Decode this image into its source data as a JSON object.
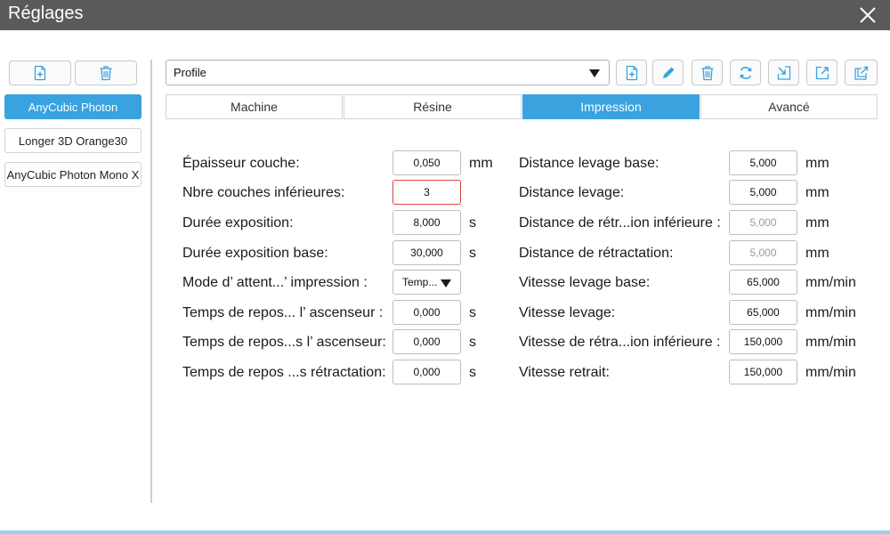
{
  "window": {
    "title": "Réglages"
  },
  "machines": [
    "AnyCubic Photon",
    "Longer 3D Orange30",
    "AnyCubic Photon Mono X"
  ],
  "profile": {
    "value": "Profile"
  },
  "tabs": [
    "Machine",
    "Résine",
    "Impression",
    "Avancé"
  ],
  "left_params": [
    {
      "label": "Épaisseur couche:",
      "value": "0,050",
      "unit": "mm"
    },
    {
      "label": "Nbre couches inférieures:",
      "value": "3",
      "unit": ""
    },
    {
      "label": "Durée exposition:",
      "value": "8,000",
      "unit": "s"
    },
    {
      "label": "Durée exposition base:",
      "value": "30,000",
      "unit": "s"
    },
    {
      "label": "Mode d’ attent...’ impression :",
      "value": "Temp...",
      "unit": ""
    },
    {
      "label": "Temps de repos... l’ ascenseur :",
      "value": "0,000",
      "unit": "s"
    },
    {
      "label": "Temps de repos...s l’ ascenseur:",
      "value": "0,000",
      "unit": "s"
    },
    {
      "label": "Temps de repos ...s rétractation:",
      "value": "0,000",
      "unit": "s"
    }
  ],
  "right_params": [
    {
      "label": "Distance levage base:",
      "value": "5,000",
      "unit": "mm"
    },
    {
      "label": "Distance levage:",
      "value": "5,000",
      "unit": "mm"
    },
    {
      "label": "Distance de rétr...ion inférieure :",
      "value": "5,000",
      "unit": "mm"
    },
    {
      "label": "Distance de rétractation:",
      "value": "5,000",
      "unit": "mm"
    },
    {
      "label": "Vitesse levage base:",
      "value": "65,000",
      "unit": "mm/min"
    },
    {
      "label": "Vitesse levage:",
      "value": "65,000",
      "unit": "mm/min"
    },
    {
      "label": "Vitesse de rétra...ion inférieure :",
      "value": "150,000",
      "unit": "mm/min"
    },
    {
      "label": "Vitesse retrait:",
      "value": "150,000",
      "unit": "mm/min"
    }
  ],
  "icons": {
    "close": "close-icon",
    "machine_add": "add-file-icon",
    "machine_delete": "trash-icon",
    "profile_toolbar": [
      "add-file-icon",
      "pencil-icon",
      "trash-icon",
      "refresh-icon",
      "import-icon",
      "export-icon",
      "copy-export-icon"
    ]
  },
  "colors": {
    "accent": "#39a2df",
    "titlebar": "#5a5a5a",
    "error_border": "#e04040",
    "bottom_accent": "#9ad2ee"
  }
}
